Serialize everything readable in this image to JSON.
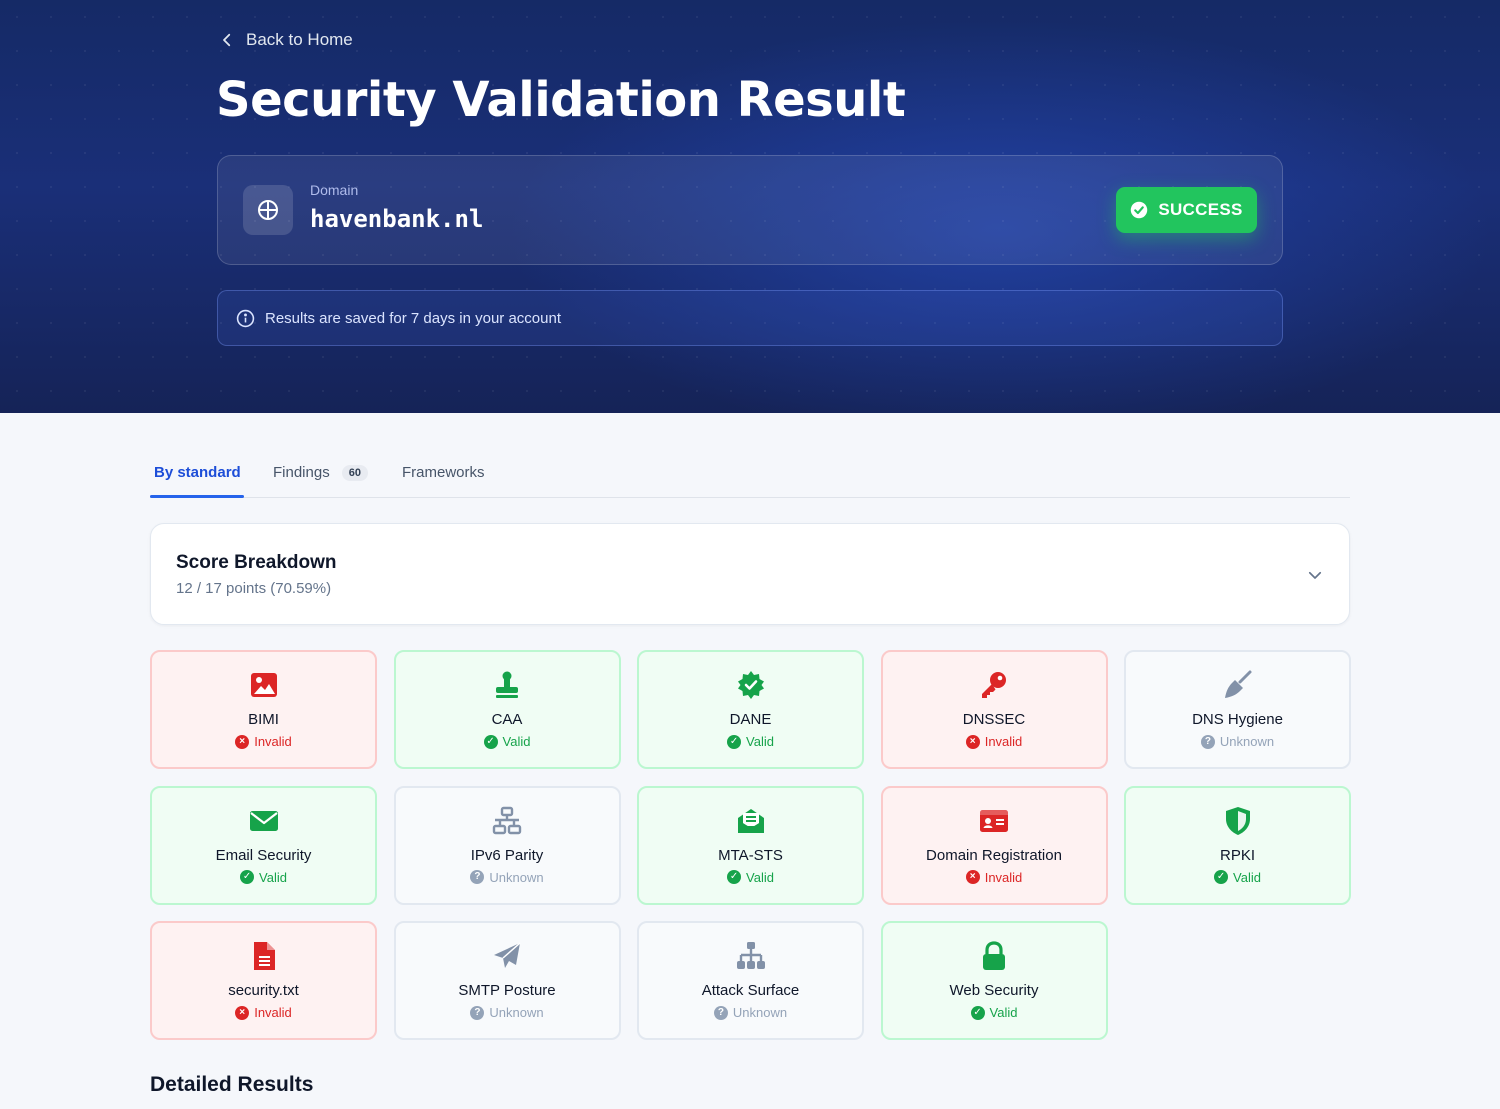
{
  "header": {
    "back_label": "Back to Home",
    "title": "Security Validation Result"
  },
  "domain_card": {
    "label": "Domain",
    "value": "havenbank.nl",
    "status": "SUCCESS"
  },
  "info": {
    "message": "Results are saved for 7 days in your account"
  },
  "tabs": [
    {
      "label": "By standard",
      "active": true
    },
    {
      "label": "Findings",
      "count": "60"
    },
    {
      "label": "Frameworks"
    }
  ],
  "score": {
    "title": "Score Breakdown",
    "summary": "12 / 17 points (70.59%)"
  },
  "standards": [
    {
      "name": "BIMI",
      "status": "Invalid",
      "state": "invalid",
      "icon": "image-icon"
    },
    {
      "name": "CAA",
      "status": "Valid",
      "state": "valid",
      "icon": "stamp-icon"
    },
    {
      "name": "DANE",
      "status": "Valid",
      "state": "valid",
      "icon": "certificate-icon"
    },
    {
      "name": "DNSSEC",
      "status": "Invalid",
      "state": "invalid",
      "icon": "key-icon"
    },
    {
      "name": "DNS Hygiene",
      "status": "Unknown",
      "state": "unknown",
      "icon": "broom-icon"
    },
    {
      "name": "Email Security",
      "status": "Valid",
      "state": "valid",
      "icon": "envelope-icon"
    },
    {
      "name": "IPv6 Parity",
      "status": "Unknown",
      "state": "unknown",
      "icon": "network-icon"
    },
    {
      "name": "MTA-STS",
      "status": "Valid",
      "state": "valid",
      "icon": "envelope-open-text-icon"
    },
    {
      "name": "Domain Registration",
      "status": "Invalid",
      "state": "invalid",
      "icon": "id-card-icon"
    },
    {
      "name": "RPKI",
      "status": "Valid",
      "state": "valid",
      "icon": "shield-icon"
    },
    {
      "name": "security.txt",
      "status": "Invalid",
      "state": "invalid",
      "icon": "file-lines-icon"
    },
    {
      "name": "SMTP Posture",
      "status": "Unknown",
      "state": "unknown",
      "icon": "paper-plane-icon"
    },
    {
      "name": "Attack Surface",
      "status": "Unknown",
      "state": "unknown",
      "icon": "sitemap-icon"
    },
    {
      "name": "Web Security",
      "status": "Valid",
      "state": "valid",
      "icon": "lock-icon"
    }
  ],
  "colors": {
    "valid": "#16a34a",
    "invalid": "#dc2626",
    "unknown": "#94a3b8",
    "success_badge": "#22c55e",
    "accent": "#2563eb"
  },
  "detailed": {
    "title": "Detailed Results"
  }
}
